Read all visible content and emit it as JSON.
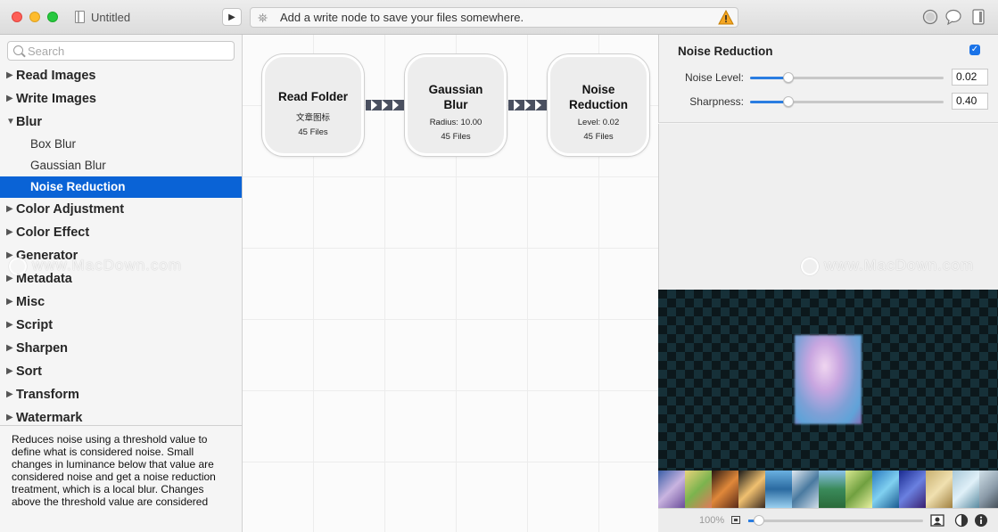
{
  "window": {
    "title": "Untitled"
  },
  "status": {
    "message": "Add a write node to save your files somewhere."
  },
  "search": {
    "placeholder": "Search"
  },
  "tree": {
    "read_images": "Read Images",
    "write_images": "Write Images",
    "blur": "Blur",
    "blur_children": [
      "Box Blur",
      "Gaussian Blur",
      "Noise Reduction"
    ],
    "color_adjustment": "Color Adjustment",
    "color_effect": "Color Effect",
    "generator": "Generator",
    "metadata": "Metadata",
    "misc": "Misc",
    "script": "Script",
    "sharpen": "Sharpen",
    "sort": "Sort",
    "transform": "Transform",
    "watermark": "Watermark"
  },
  "description": "Reduces noise using a threshold value to define what is considered noise. Small changes in luminance below that value are considered noise and get a noise reduction treatment, which is a local blur. Changes above the threshold value are considered",
  "nodes": [
    {
      "title": "Read Folder",
      "line1": "文章图标",
      "line2": "45 Files"
    },
    {
      "title": "Gaussian Blur",
      "line1": "Radius: 10.00",
      "line2": "45 Files"
    },
    {
      "title": "Noise Reduction",
      "line1": "Level: 0.02",
      "line2": "45 Files"
    }
  ],
  "inspector": {
    "title": "Noise Reduction",
    "enabled": true,
    "params": [
      {
        "label": "Noise Level:",
        "value": "0.02",
        "fraction": 0.2
      },
      {
        "label": "Sharpness:",
        "value": "0.40",
        "fraction": 0.2
      }
    ]
  },
  "preview": {
    "zoom": "100%",
    "zoom_fraction": 0.06
  },
  "watermark": {
    "text": "www.MacDown.com"
  },
  "colors": {
    "accent": "#0a63d6",
    "connector": "#4a5060"
  },
  "icons": [
    "play-icon",
    "satellite-icon",
    "warning-icon",
    "record-icon",
    "comment-icon",
    "document-icon",
    "search-icon",
    "fit-icon",
    "portrait-icon",
    "contrast-icon",
    "info-icon"
  ]
}
